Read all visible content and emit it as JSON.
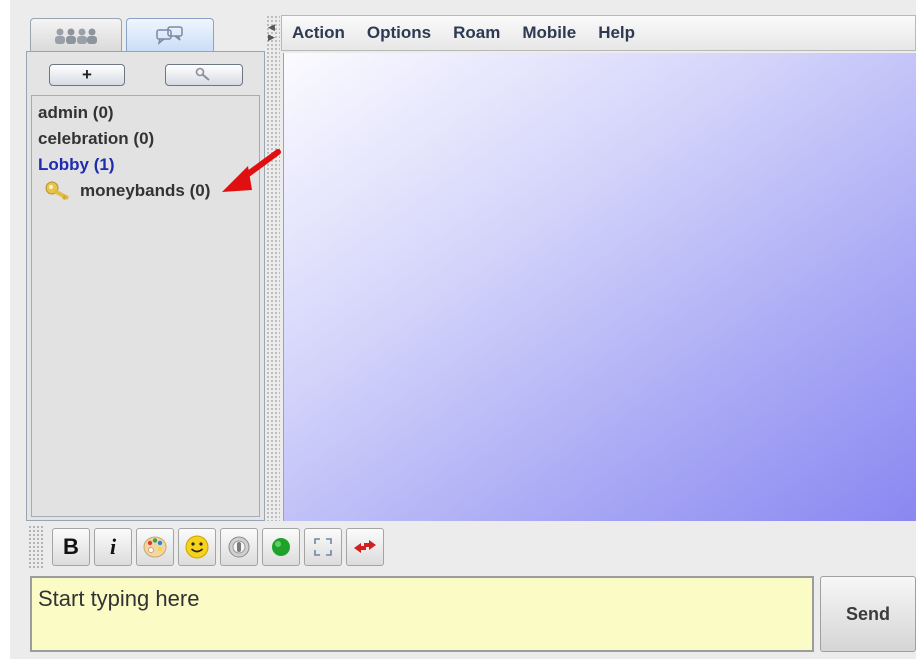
{
  "tabs": [
    {
      "name": "users-tab",
      "icon": "people-icon"
    },
    {
      "name": "rooms-tab",
      "icon": "chat-bubbles-icon",
      "selected": true
    }
  ],
  "left_toolbar": {
    "add_label": "+",
    "search_icon": "magnifier-icon"
  },
  "rooms": [
    {
      "label": "admin (0)",
      "active": false,
      "locked": false
    },
    {
      "label": "celebration (0)",
      "active": false,
      "locked": false
    },
    {
      "label": "Lobby (1)",
      "active": true,
      "locked": false
    },
    {
      "label": "moneybands (0)",
      "active": false,
      "locked": true,
      "icon": "key-icon"
    }
  ],
  "menu": {
    "items": [
      "Action",
      "Options",
      "Roam",
      "Mobile",
      "Help"
    ]
  },
  "format_toolbar": {
    "bold_label": "B",
    "italic_label": "i",
    "icons": [
      "bold-icon",
      "italic-icon",
      "palette-icon",
      "smiley-icon",
      "sound-icon",
      "status-green-icon",
      "fullscreen-icon",
      "swap-arrows-icon"
    ]
  },
  "input": {
    "placeholder": "Start typing here"
  },
  "send_label": "Send",
  "colors": {
    "active_room": "#1f2bb0",
    "input_bg": "#fbfbc6",
    "annotation_arrow": "#e01010"
  }
}
